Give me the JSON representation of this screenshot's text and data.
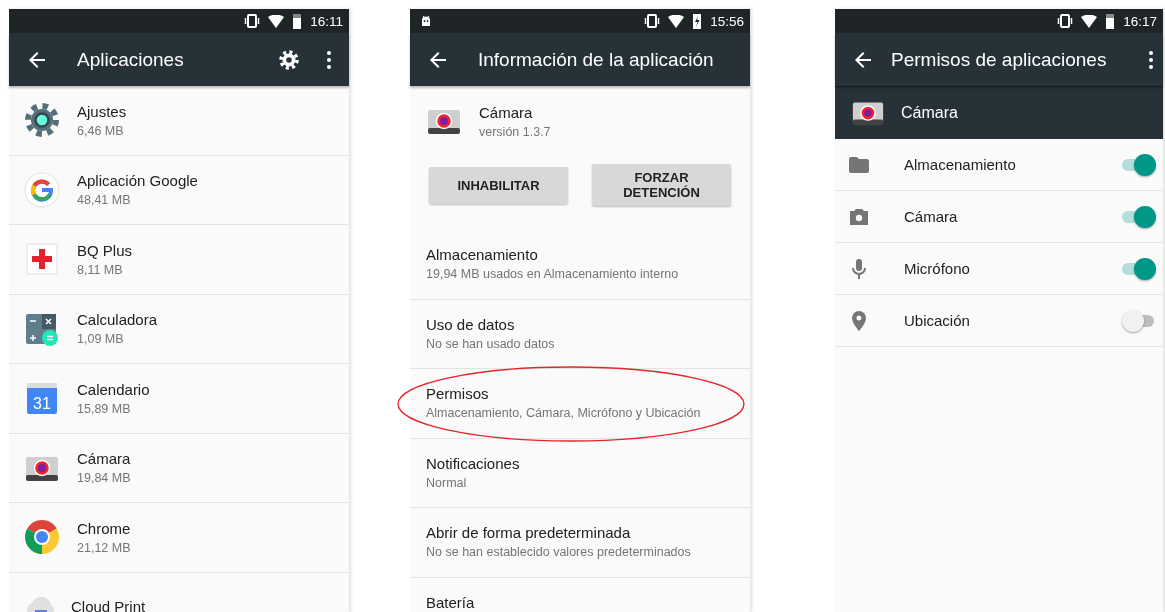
{
  "screens": [
    {
      "kind": "app_list",
      "status_bar": {
        "time": "16:11",
        "charging": false
      },
      "toolbar": {
        "title": "Aplicaciones"
      },
      "apps": [
        {
          "name": "Ajustes",
          "size": "6,46 MB"
        },
        {
          "name": "Aplicación Google",
          "size": "48,41 MB"
        },
        {
          "name": "BQ Plus",
          "size": "8,11 MB"
        },
        {
          "name": "Calculadora",
          "size": "1,09 MB"
        },
        {
          "name": "Calendario",
          "size": "15,89 MB",
          "icon_text": "31"
        },
        {
          "name": "Cámara",
          "size": "19,84 MB"
        },
        {
          "name": "Chrome",
          "size": "21,12 MB"
        },
        {
          "name": "Cloud Print"
        }
      ]
    },
    {
      "kind": "app_info",
      "status_bar": {
        "time": "15:56",
        "charging": true
      },
      "toolbar": {
        "title": "Información de la aplicación"
      },
      "app": {
        "name": "Cámara",
        "version": "versión 1.3.7"
      },
      "buttons": [
        "INHABILITAR",
        "FORZAR DETENCIÓN"
      ],
      "items": [
        {
          "title": "Almacenamiento",
          "subtitle": "19,94 MB usados en Almacenamiento interno",
          "circled": false
        },
        {
          "title": "Uso de datos",
          "subtitle": "No se han usado datos",
          "circled": false
        },
        {
          "title": "Permisos",
          "subtitle": "Almacenamiento, Cámara, Micrófono y Ubicación",
          "circled": true
        },
        {
          "title": "Notificaciones",
          "subtitle": "Normal",
          "circled": false
        },
        {
          "title": "Abrir de forma predeterminada",
          "subtitle": "No se han establecido valores predeterminados",
          "circled": false
        },
        {
          "title": "Batería",
          "circled": false
        }
      ]
    },
    {
      "kind": "permissions",
      "status_bar": {
        "time": "16:17",
        "charging": false
      },
      "toolbar": {
        "title": "Permisos de aplicaciones"
      },
      "app": {
        "name": "Cámara"
      },
      "permissions": [
        {
          "name": "Almacenamiento",
          "on": true
        },
        {
          "name": "Cámara",
          "on": true
        },
        {
          "name": "Micrófono",
          "on": true
        },
        {
          "name": "Ubicación",
          "on": false
        }
      ]
    }
  ]
}
